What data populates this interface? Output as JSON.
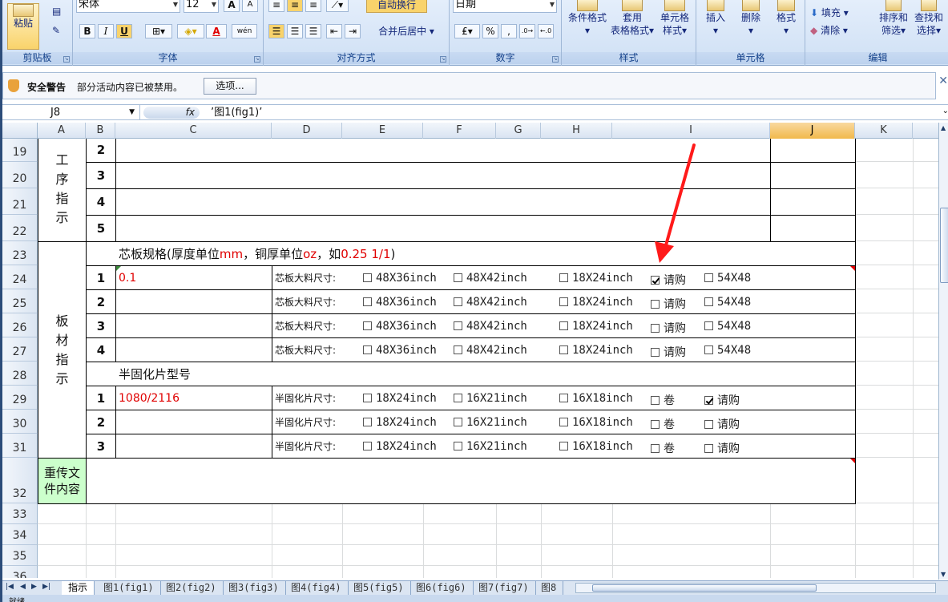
{
  "ribbon": {
    "clipboard": {
      "paste": "粘贴",
      "label": "剪贴板"
    },
    "font": {
      "name": "宋体",
      "size": "12",
      "label": "字体",
      "bold": "B",
      "italic": "I",
      "underline": "U",
      "grow": "A",
      "shrink": "A",
      "font_color": "A",
      "phonetic": "wén"
    },
    "alignment": {
      "wrap": "自动换行",
      "merge": "合并后居中",
      "label": "对齐方式"
    },
    "number": {
      "format": "日期",
      "percent": "%",
      "comma": ",",
      "label": "数字"
    },
    "styles": {
      "conditional": "条件格式",
      "table_line1": "套用",
      "table_line2": "表格格式",
      "cell_line1": "单元格",
      "cell_line2": "样式",
      "label": "样式"
    },
    "cells": {
      "insert": "插入",
      "delete": "删除",
      "format": "格式",
      "label": "单元格"
    },
    "editing": {
      "fill": "填充",
      "clear": "清除",
      "sort_line1": "排序和",
      "sort_line2": "筛选",
      "find_line1": "查找和",
      "find_line2": "选择",
      "label": "编辑"
    }
  },
  "security": {
    "title": "安全警告",
    "message": "部分活动内容已被禁用。",
    "options": "选项..."
  },
  "formula_bar": {
    "name_box": "J8",
    "fx": "fx",
    "value": "’图1(fig1)’"
  },
  "columns": [
    "A",
    "B",
    "C",
    "D",
    "E",
    "F",
    "G",
    "H",
    "I",
    "J",
    "K"
  ],
  "selected_column": "J",
  "rows": [
    "19",
    "20",
    "21",
    "22",
    "23",
    "24",
    "25",
    "26",
    "27",
    "28",
    "29",
    "30",
    "31",
    "32",
    "33",
    "34",
    "35",
    "36"
  ],
  "sheet": {
    "process_label": "工序指示",
    "process_nums": [
      "2",
      "3",
      "4",
      "5"
    ],
    "core_header_a": "芯板规格(厚度单位",
    "core_header_mm": "mm",
    "core_header_b": "，铜厚单位",
    "core_header_oz": "oz",
    "core_header_c": "，如",
    "core_header_ex": "0.25 1/1",
    "core_header_d": ")",
    "board_label": "板材指示",
    "core_rows": [
      {
        "num": "1",
        "value": "0.1",
        "label": "芯板大料尺寸:",
        "opts": [
          "48X36inch",
          "48X42inch",
          "18X24inch",
          "请购",
          "54X48"
        ],
        "checked": [
          false,
          false,
          false,
          true,
          false
        ]
      },
      {
        "num": "2",
        "value": "",
        "label": "芯板大料尺寸:",
        "opts": [
          "48X36inch",
          "48X42inch",
          "18X24inch",
          "请购",
          "54X48"
        ],
        "checked": [
          false,
          false,
          false,
          false,
          false
        ]
      },
      {
        "num": "3",
        "value": "",
        "label": "芯板大料尺寸:",
        "opts": [
          "48X36inch",
          "48X42inch",
          "18X24inch",
          "请购",
          "54X48"
        ],
        "checked": [
          false,
          false,
          false,
          false,
          false
        ]
      },
      {
        "num": "4",
        "value": "",
        "label": "芯板大料尺寸:",
        "opts": [
          "48X36inch",
          "48X42inch",
          "18X24inch",
          "请购",
          "54X48"
        ],
        "checked": [
          false,
          false,
          false,
          false,
          false
        ]
      }
    ],
    "prepreg_header": "半固化片型号",
    "prepreg_rows": [
      {
        "num": "1",
        "value": "1080/2116",
        "label": "半固化片尺寸:",
        "opts": [
          "18X24inch",
          "16X21inch",
          "16X18inch",
          "卷",
          "请购"
        ],
        "checked": [
          false,
          false,
          false,
          false,
          true
        ]
      },
      {
        "num": "2",
        "value": "",
        "label": "半固化片尺寸:",
        "opts": [
          "18X24inch",
          "16X21inch",
          "16X18inch",
          "卷",
          "请购"
        ],
        "checked": [
          false,
          false,
          false,
          false,
          false
        ]
      },
      {
        "num": "3",
        "value": "",
        "label": "半固化片尺寸:",
        "opts": [
          "18X24inch",
          "16X21inch",
          "16X18inch",
          "卷",
          "请购"
        ],
        "checked": [
          false,
          false,
          false,
          false,
          false
        ]
      }
    ],
    "reupload_label": "重传文件内容"
  },
  "tabs": [
    "指示",
    "图1(fig1)",
    "图2(fig2)",
    "图3(fig3)",
    "图4(fig4)",
    "图5(fig5)",
    "图6(fig6)",
    "图7(fig7)",
    "图8"
  ],
  "active_tab": "指示",
  "status": "就绪",
  "colors": {
    "accent": "#e00000",
    "selected_col": "#f1b94b",
    "label_green": "#ccffcc"
  }
}
